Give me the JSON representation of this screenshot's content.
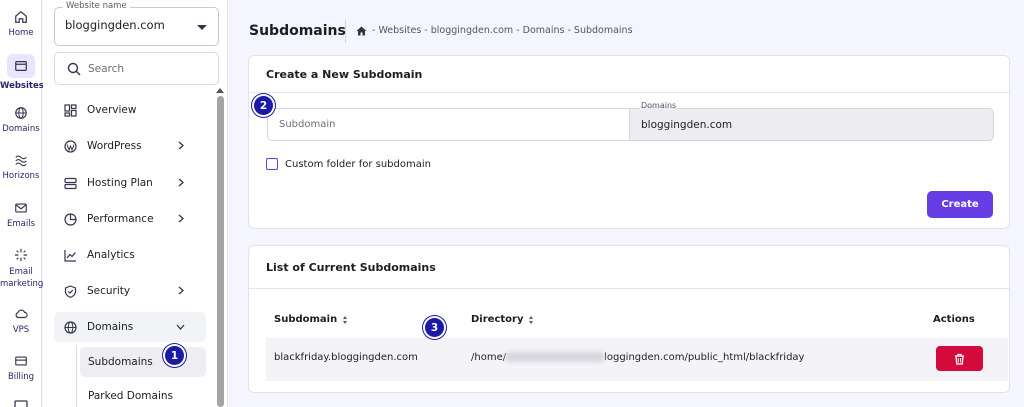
{
  "rail": {
    "items": [
      {
        "label": "Home",
        "icon": "home-icon"
      },
      {
        "label": "Websites",
        "icon": "websites-icon",
        "active": true
      },
      {
        "label": "Domains",
        "icon": "globe-icon"
      },
      {
        "label": "Horizons",
        "icon": "horizons-icon"
      },
      {
        "label": "Emails",
        "icon": "mail-icon"
      },
      {
        "label": "Email marketing",
        "icon": "sparkle-icon"
      },
      {
        "label": "VPS",
        "icon": "cloud-icon"
      },
      {
        "label": "Billing",
        "icon": "card-icon"
      }
    ]
  },
  "sidebar": {
    "website_legend": "Website name",
    "website_value": "bloggingden.com",
    "search_placeholder": "Search",
    "items": [
      {
        "label": "Overview",
        "icon": "overview-icon"
      },
      {
        "label": "WordPress",
        "icon": "wordpress-icon"
      },
      {
        "label": "Hosting Plan",
        "icon": "server-icon"
      },
      {
        "label": "Performance",
        "icon": "gauge-icon"
      },
      {
        "label": "Analytics",
        "icon": "chart-icon"
      },
      {
        "label": "Security",
        "icon": "shield-icon"
      },
      {
        "label": "Domains",
        "icon": "globe-icon"
      }
    ],
    "sub_items": [
      {
        "label": "Subdomains",
        "active": true
      },
      {
        "label": "Parked Domains"
      }
    ]
  },
  "header": {
    "title": "Subdomains",
    "breadcrumb": "- Websites - bloggingden.com - Domains - Subdomains"
  },
  "create_card": {
    "title": "Create a New Subdomain",
    "subdomain_placeholder": "Subdomain",
    "domains_legend": "Domains",
    "domains_value": "bloggingden.com",
    "checkbox_label": "Custom folder for subdomain",
    "create_label": "Create"
  },
  "list_card": {
    "title": "List of Current Subdomains",
    "headers": {
      "subdomain": "Subdomain",
      "directory": "Directory",
      "actions": "Actions"
    },
    "rows": [
      {
        "subdomain": "blackfriday.bloggingden.com",
        "directory_prefix": "/home/",
        "directory_suffix": "loggingden.com/public_html/blackfriday"
      }
    ]
  },
  "annotations": [
    "1",
    "2",
    "3"
  ],
  "colors": {
    "accent": "#673de6",
    "danger": "#d30a3b",
    "badge": "#1a1aa6"
  }
}
